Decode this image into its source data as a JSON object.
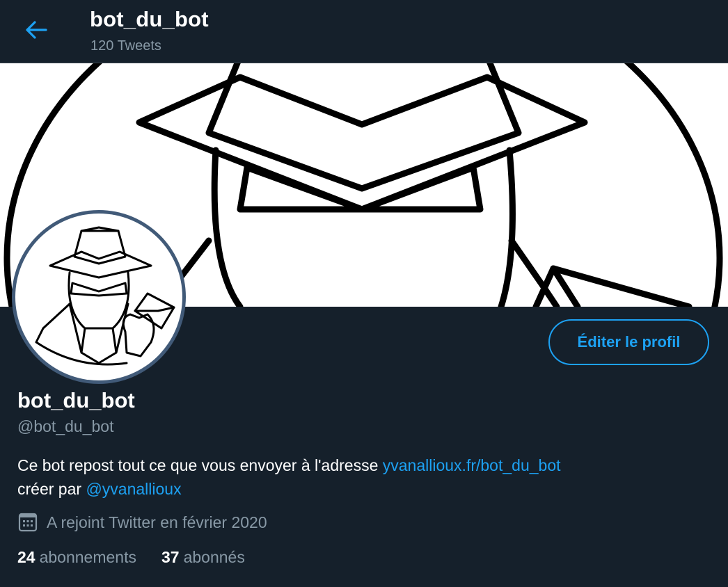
{
  "header": {
    "back_icon": "arrow-left-icon",
    "title": "bot_du_bot",
    "subtitle": "120 Tweets"
  },
  "banner": {
    "image": "spy-with-hat-and-envelope-illustration"
  },
  "profile": {
    "avatar_image": "spy-with-hat-and-envelope-illustration",
    "edit_button": "Éditer le profil",
    "display_name": "bot_du_bot",
    "handle": "@bot_du_bot",
    "bio": {
      "text_1": "Ce bot repost tout ce que vous envoyer à l'adresse ",
      "link_1": "yvanallioux.fr/bot_du_bot",
      "text_2": "créer par ",
      "link_2": "@yvanallioux"
    },
    "joined_icon": "calendar-icon",
    "joined": "A rejoint Twitter en février 2020",
    "following_count": "24",
    "following_label": "abonnements",
    "followers_count": "37",
    "followers_label": "abonnés"
  },
  "colors": {
    "background": "#15202b",
    "accent": "#1da1f2",
    "secondary_text": "#8899a6",
    "avatar_ring": "#415a78"
  }
}
